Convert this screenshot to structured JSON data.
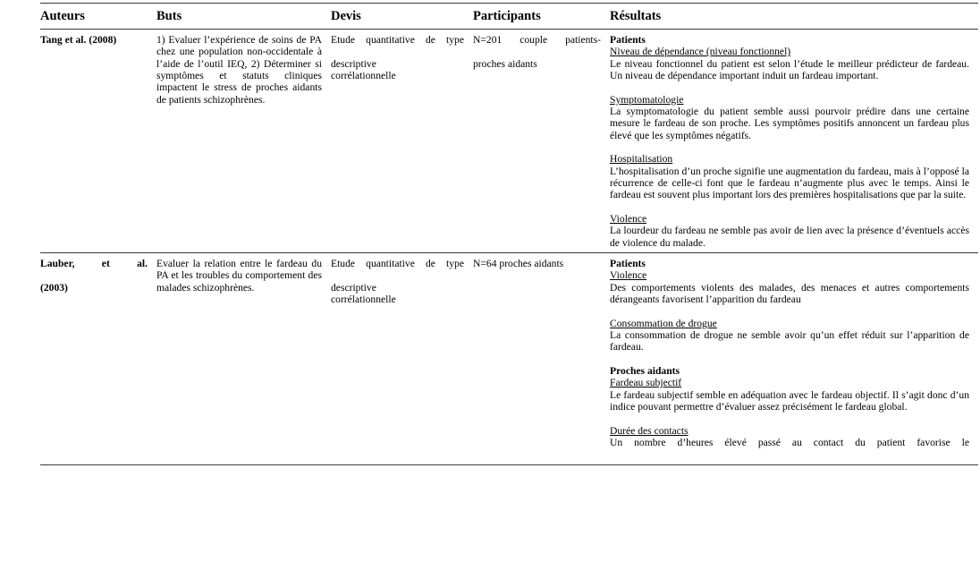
{
  "table": {
    "columns": [
      {
        "key": "auteurs",
        "label": "Auteurs"
      },
      {
        "key": "buts",
        "label": "Buts"
      },
      {
        "key": "devis",
        "label": "Devis"
      },
      {
        "key": "participants",
        "label": "Participants"
      },
      {
        "key": "resultats",
        "label": "Résultats"
      }
    ],
    "rows": [
      {
        "auteurs": "Tang et al. (2008)",
        "buts": "1) Evaluer l’expérience de soins de PA chez une population non-occidentale à l’aide de l’outil IEQ, 2) Déterminer si symptômes et statuts cliniques impactent le stress de proches aidants de patients schizophrènes.",
        "devis_line1": "Etude quantitative de type",
        "devis_line2": "descriptive",
        "devis_line3": "corrélationnelle",
        "participants_line1": "N=201 couple patients-",
        "participants_line2": "proches aidants",
        "resultats": {
          "groups": [
            {
              "heading": "Patients",
              "sub": "Niveau de dépendance (niveau fonctionnel)",
              "body": "Le niveau fonctionnel du patient est selon l’étude le meilleur prédicteur de fardeau. Un niveau de dépendance important induit un fardeau important."
            },
            {
              "heading": "",
              "sub": "Symptomatologie",
              "body": "La symptomatologie du patient semble aussi pourvoir prédire dans une certaine mesure le fardeau de son proche. Les symptômes positifs annoncent un fardeau plus élevé que les symptômes négatifs."
            },
            {
              "heading": "",
              "sub": "Hospitalisation",
              "body": "L’hospitalisation d’un proche signifie une augmentation du fardeau, mais à l’opposé la récurrence de celle-ci font que le fardeau n’augmente plus avec le temps. Ainsi le fardeau est souvent plus important lors des premières hospitalisations que par la suite."
            },
            {
              "heading": "",
              "sub": "Violence",
              "body": "La lourdeur du fardeau ne semble pas avoir de lien avec la présence d’éventuels accès de violence du malade."
            }
          ]
        }
      },
      {
        "auteurs_line1": "Lauber, et al.",
        "auteurs_line2": "(2003)",
        "buts": "Evaluer la relation entre le fardeau du PA et les troubles du comportement des malades schizophrènes.",
        "devis_line1": "Etude quantitative de type",
        "devis_line2": "descriptive",
        "devis_line3": "corrélationnelle",
        "participants_line1": "N=64 proches aidants",
        "participants_line2": "",
        "resultats": {
          "groups": [
            {
              "heading": "Patients",
              "sub": "Violence",
              "body": "Des comportements violents des malades, des menaces et autres comportements dérangeants favorisent l’apparition du fardeau"
            },
            {
              "heading": "",
              "sub": "Consommation de drogue",
              "body": "La consommation de drogue ne semble avoir qu’un effet réduit sur l’apparition de fardeau."
            },
            {
              "heading": "Proches aidants",
              "sub": "Fardeau subjectif",
              "body": "Le fardeau subjectif semble en adéquation avec le fardeau objectif. Il s’agit donc d’un indice pouvant permettre d’évaluer assez précisément le fardeau global."
            },
            {
              "heading": "",
              "sub": "Durée des contacts",
              "body": "Un nombre d’heures élevé passé au contact du patient favorise le"
            }
          ]
        }
      }
    ]
  }
}
